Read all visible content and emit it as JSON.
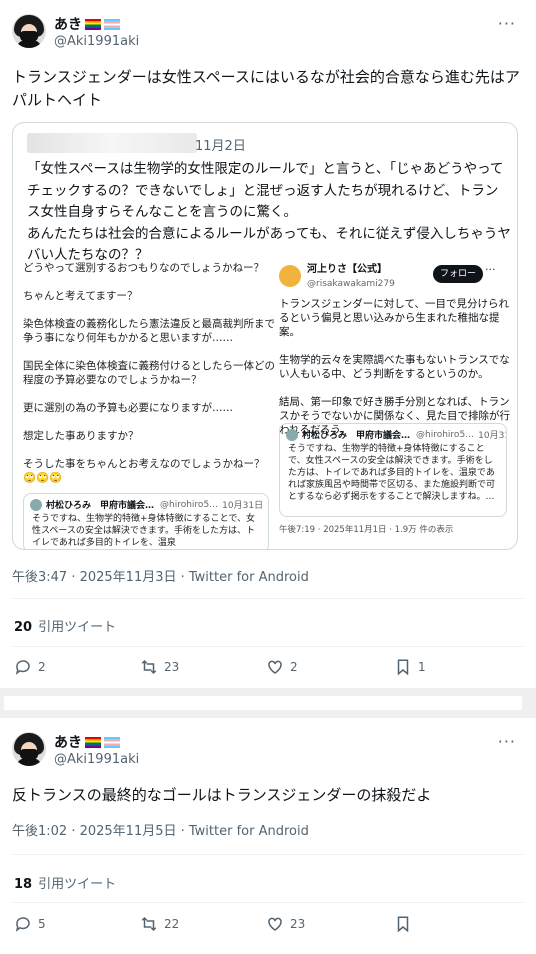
{
  "tweet1": {
    "display_name": "あき",
    "handle": "@Aki1991aki",
    "more": "···",
    "text": "トランスジェンダーは女性スペースにはいるなが社会的合意なら進む先はアパルトヘイト",
    "quote": {
      "date": "11月2日",
      "text": "「女性スペースは生物学的女性限定のルールで」と言うと、「じゃあどうやって チェックするの？できないでしょ」と混ぜっ返す人たちが現れるけど、トランス女性自身すらそんなことを言うのに驚く。\nあんたたちは社会的合意によるルールがあっても、それに従えず侵入しちゃうヤバい人たちなの？？",
      "image": {
        "left": {
          "p1": "どうやって選別するおつもりなのでしょうかねー？",
          "p2": "ちゃんと考えてますー？",
          "p3": "染色体検査の義務化したら憲法違反と最高裁判所まで争う事になり何年もかかると思いますが……",
          "p4": "国民全体に染色体検査に義務付けるとしたら一体どの程度の予算必要なのでしょうかねー？",
          "p5": "更に選別の為の予算も必要になりますが……",
          "p6": "想定した事ありますか？",
          "p7": "そうした事をちゃんとお考えなのでしょうかねー？🙄🙄🙄",
          "card": {
            "name": "村松ひろみ　甲府市議会…",
            "handle": "@hirohiro5…",
            "date": "10月31日",
            "body": "そうですね、生物学的特徴+身体特徴にすることで、女性スペースの安全は解決できます。手術をした方は、トイレであれば多目的トイレを、温泉"
          }
        },
        "right": {
          "name": "河上りさ【公式】",
          "handle": "@risakawakami279",
          "follow": "フォロー",
          "more": "···",
          "p1": "トランスジェンダーに対して、一目で見分けられるという偏見と思い込みから生まれた稚拙な提案。",
          "p2": "生物学的云々を実際調べた事もないトランスでない人もいる中、どう判断をするというのか。",
          "p3": "結局、第一印象で好き勝手分別となれば、トランスかそうでないかに関係なく、見た目で排除が行われるだろう。",
          "card": {
            "name": "村松ひろみ　甲府市議会…",
            "handle": "@hirohiro5…",
            "date": "10月31日",
            "body": "そうですね、生物学的特徴+身体特徴にすることで、女性スペースの安全は解決できます。手術をした方は、トイレであれば多目的トイレを、温泉であれば家族風呂や時間帯で区切る、また施設判断で可とするなら必ず掲示をすることで解決しますね。…"
          },
          "meta": "午後7:19 · 2025年11月1日 · 1.9万 件の表示"
        }
      }
    },
    "meta": "午後3:47 · 2025年11月3日 · Twitter for Android",
    "quote_count": "20",
    "quote_label": "引用ツイート",
    "replies": "2",
    "retweets": "23",
    "likes": "2",
    "bookmarks": "1"
  },
  "tweet2": {
    "display_name": "あき",
    "handle": "@Aki1991aki",
    "more": "···",
    "text": "反トランスの最終的なゴールはトランスジェンダーの抹殺だよ",
    "meta": "午後1:02 · 2025年11月5日 · Twitter for Android",
    "quote_count": "18",
    "quote_label": "引用ツイート",
    "replies": "5",
    "retweets": "22",
    "likes": "23",
    "bookmarks": ""
  }
}
